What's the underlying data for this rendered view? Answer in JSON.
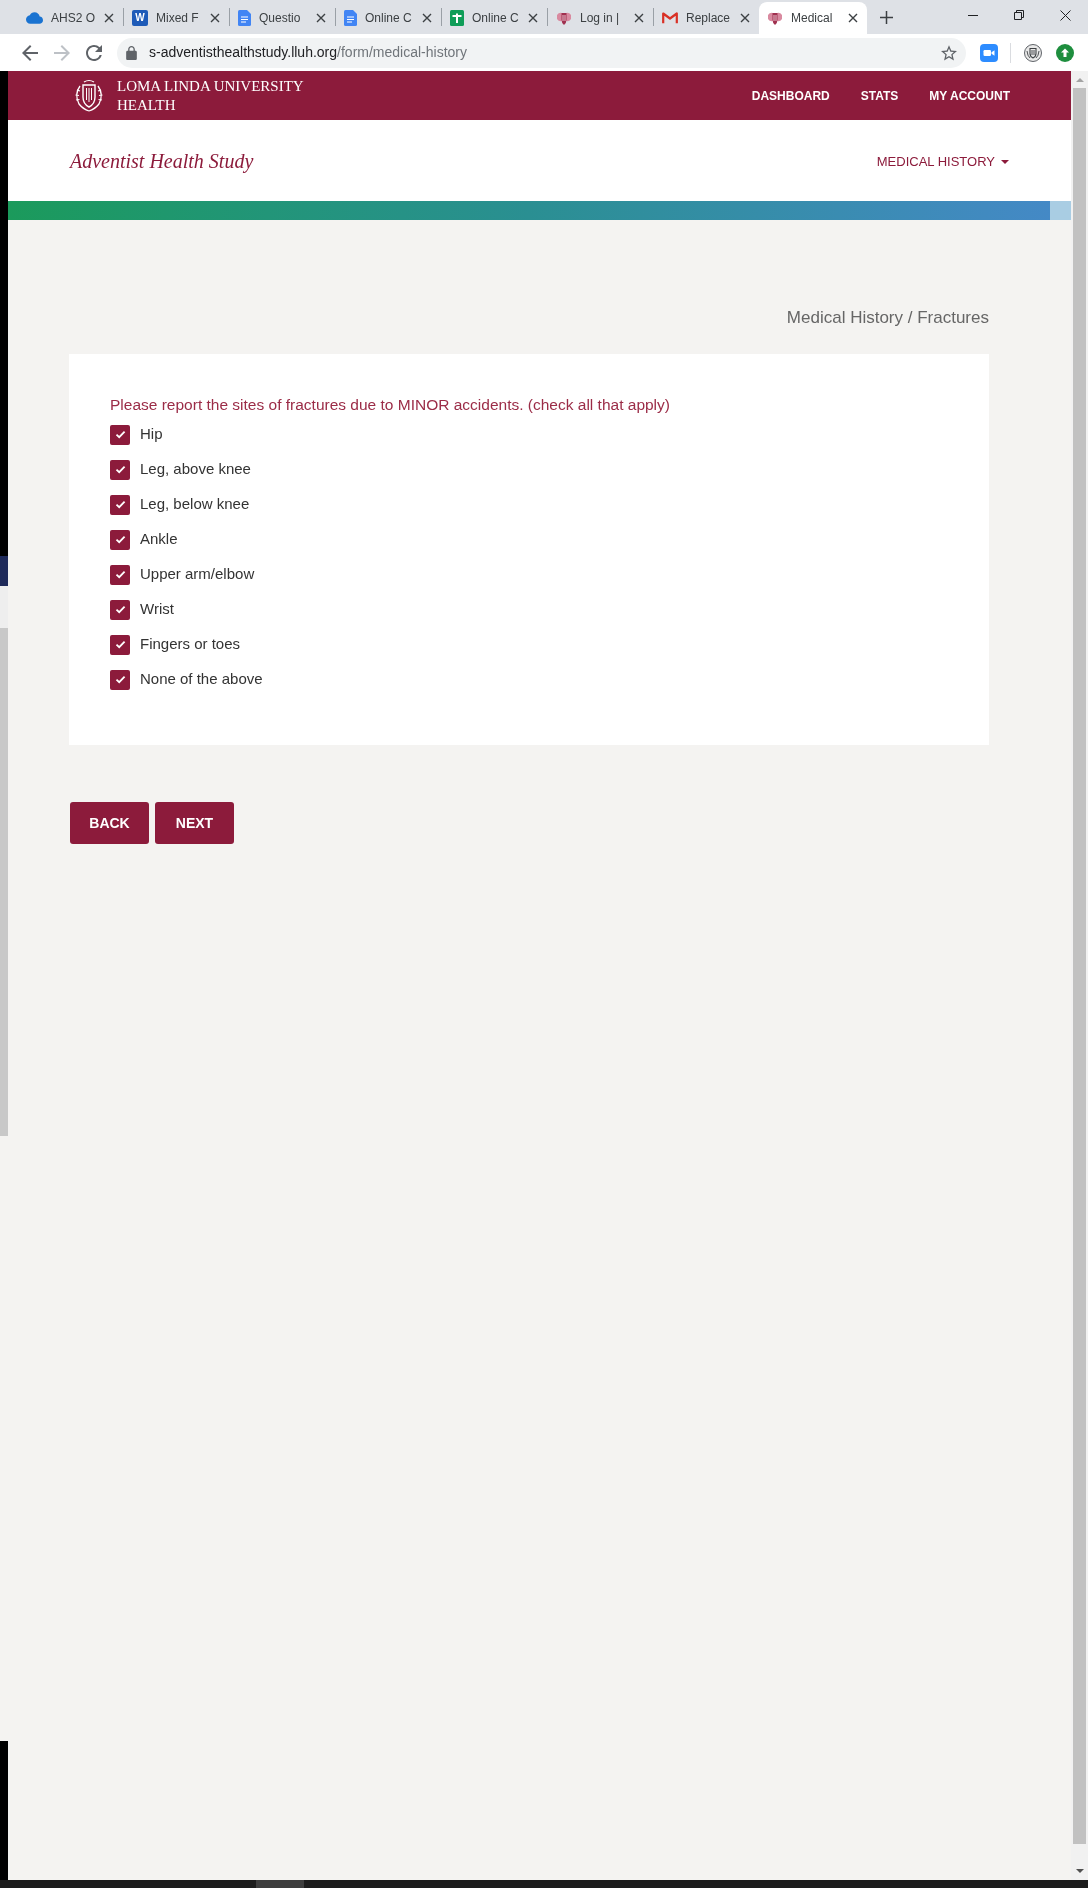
{
  "browser": {
    "tabs": [
      {
        "kind": "cloud",
        "title": "AHS2 O",
        "selected": false
      },
      {
        "kind": "letter",
        "icon_text": "W",
        "title": "Mixed F",
        "selected": false
      },
      {
        "kind": "docs",
        "title": "Questio",
        "selected": false
      },
      {
        "kind": "docs",
        "title": "Online C",
        "selected": false
      },
      {
        "kind": "sheet",
        "title": "Online C",
        "selected": false
      },
      {
        "kind": "crest",
        "title": "Log in |",
        "selected": false
      },
      {
        "kind": "mail",
        "title": "Replace",
        "selected": false
      },
      {
        "kind": "crest",
        "title": "Medical",
        "selected": true
      }
    ],
    "forward_disabled": true,
    "url": {
      "domain": "s-adventisthealthstudy.lluh.org",
      "path": "/form/medical-history"
    }
  },
  "header": {
    "logo_lines": [
      "LOMA LINDA UNIVERSITY",
      "HEALTH"
    ],
    "nav": [
      "DASHBOARD",
      "STATS",
      "MY ACCOUNT"
    ]
  },
  "subheader": {
    "title": "Adventist Health Study",
    "menu": "MEDICAL HISTORY"
  },
  "breadcrumb": "Medical History / Fractures",
  "question": {
    "prompt": "Please report the sites of fractures due to MINOR accidents. (check all that apply)",
    "options": [
      {
        "label": "Hip",
        "checked": true
      },
      {
        "label": "Leg, above knee",
        "checked": true
      },
      {
        "label": "Leg, below knee",
        "checked": true
      },
      {
        "label": "Ankle",
        "checked": true
      },
      {
        "label": "Upper arm/elbow",
        "checked": true
      },
      {
        "label": "Wrist",
        "checked": true
      },
      {
        "label": "Fingers or toes",
        "checked": true
      },
      {
        "label": "None of the above",
        "checked": true
      }
    ]
  },
  "buttons": [
    "BACK",
    "NEXT"
  ]
}
